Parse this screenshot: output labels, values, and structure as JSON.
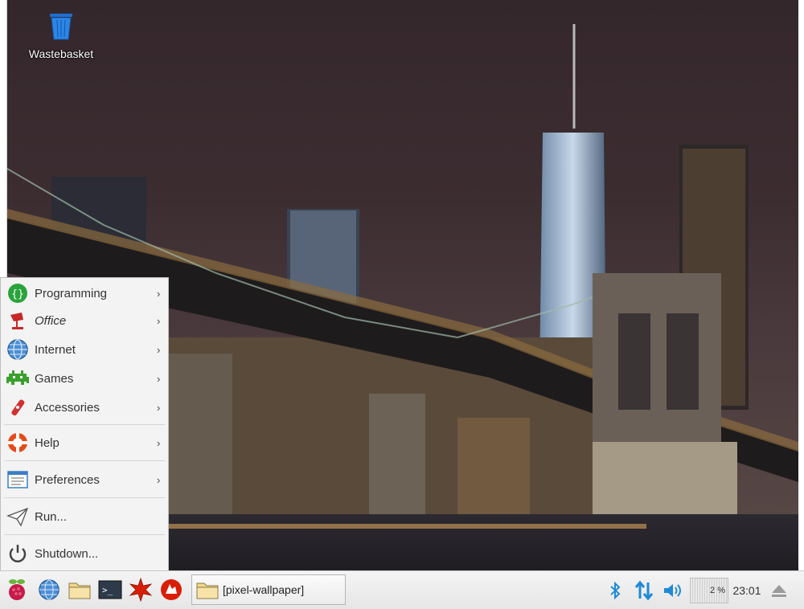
{
  "desktop": {
    "icons": [
      {
        "label": "Wastebasket",
        "icon": "trash-icon"
      }
    ]
  },
  "start_menu": {
    "items": [
      {
        "label": "Programming",
        "icon": "programming-icon",
        "has_submenu": true
      },
      {
        "label": "Office",
        "icon": "office-icon",
        "has_submenu": true
      },
      {
        "label": "Internet",
        "icon": "globe-icon",
        "has_submenu": true
      },
      {
        "label": "Games",
        "icon": "games-icon",
        "has_submenu": true
      },
      {
        "label": "Accessories",
        "icon": "accessories-icon",
        "has_submenu": true
      },
      {
        "label": "Help",
        "icon": "help-icon",
        "has_submenu": true
      },
      {
        "label": "Preferences",
        "icon": "preferences-icon",
        "has_submenu": true
      },
      {
        "label": "Run...",
        "icon": "run-icon",
        "has_submenu": false
      },
      {
        "label": "Shutdown...",
        "icon": "power-icon",
        "has_submenu": false
      }
    ],
    "submenu_arrow": "›"
  },
  "taskbar": {
    "launchers": [
      "raspberry-menu-icon",
      "web-browser-icon",
      "file-manager-icon",
      "terminal-icon",
      "mathematica-icon",
      "wolfram-icon"
    ],
    "task_window_label": "[pixel-wallpaper]",
    "tray": {
      "icons": [
        "bluetooth-icon",
        "network-icon",
        "volume-icon",
        "eject-icon"
      ],
      "cpu_label": "2 %",
      "clock": "23:01"
    }
  },
  "colors": {
    "menu_bg": "#f3f3f3",
    "taskbar_bg": "#ececec",
    "tray_blue": "#1e8ad6",
    "raspberry_red": "#c51a4a"
  }
}
